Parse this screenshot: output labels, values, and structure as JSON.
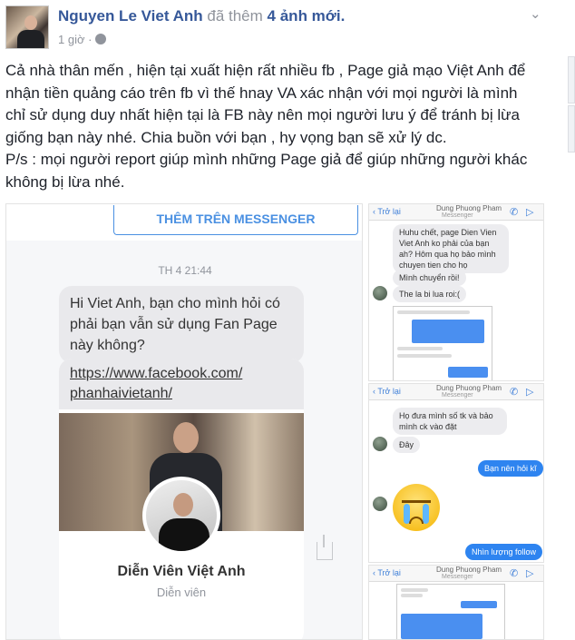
{
  "post": {
    "author": "Nguyen Le Viet Anh",
    "action_prefix": "đã thêm",
    "action_count": "4 ảnh mới.",
    "time": "1 giờ ·",
    "text_lines": [
      "Cả nhà thân mến , hiện tại xuất hiện rất nhiều fb , Page giả mạo Việt Anh để",
      "nhận tiền quảng cáo trên fb vì thế hnay VA xác nhận với mọi người là mình",
      "chỉ sử dụng duy nhất hiện tại là FB này nên mọi người lưu ý để tránh bị lừa",
      "giống bạn này nhé. Chia buồn với bạn , hy vọng bạn sẽ xử lý dc.",
      "P/s : mọi người report giúp mình những Page giả để giúp những người khác",
      "không bị lừa nhé."
    ]
  },
  "main_image": {
    "messenger_button": "THÊM TRÊN MESSENGER",
    "timestamp": "TH 4 21:44",
    "message": "Hi Viet Anh, bạn cho mình hỏi có phải bạn vẫn sử dụng Fan Page này không?",
    "link_line1": "https://www.facebook.com/",
    "link_line2": "phanhaivietanh/",
    "page_name": "Diễn Viên Việt Anh",
    "page_category": "Diễn viên"
  },
  "screens": {
    "back_label": "Trở lại",
    "title": "Dung Phuong Pham",
    "subtitle": "Messenger",
    "s1_msg1": "Huhu chết, page Dien Vien Viet Anh ko phải của bạn ah? Hôm qua họ bảo mình chuyen tien cho họ",
    "s1_msg2": "Mình chuyển rồi!",
    "s1_msg3": "The la bi lua roi:(",
    "s2_msg1": "Họ đưa mình số tk và bảo mình ck vào đặt",
    "s2_msg2": "Đây",
    "s2_msg3": "Bạn nên hỏi kĩ",
    "s2_msg4": "Nhìn lượng follow"
  }
}
